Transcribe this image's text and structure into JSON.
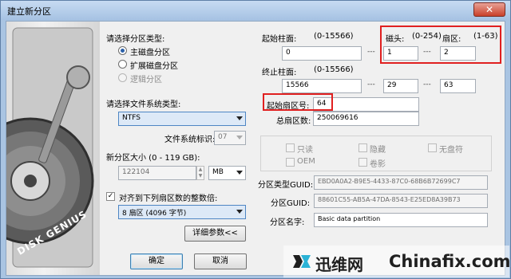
{
  "window": {
    "title": "建立新分区",
    "close_glyph": "✕"
  },
  "partition_type": {
    "label": "请选择分区类型:",
    "options": [
      {
        "label": "主磁盘分区",
        "selected": true,
        "enabled": true
      },
      {
        "label": "扩展磁盘分区",
        "selected": false,
        "enabled": true
      },
      {
        "label": "逻辑分区",
        "selected": false,
        "enabled": false
      }
    ]
  },
  "filesystem": {
    "label": "请选择文件系统类型:",
    "value": "NTFS",
    "id_label": "文件系统标识:",
    "id_value": "07"
  },
  "size": {
    "label": "新分区大小 (0 - 119 GB):",
    "value": "122104",
    "unit": "MB"
  },
  "align": {
    "checked": true,
    "label": "对齐到下列扇区数的整数倍:",
    "value": "8 扇区 (4096 字节)",
    "check_glyph": "✓"
  },
  "advanced_button": "详细参数<<",
  "start_cylinder": {
    "label": "起始柱面:",
    "range": "(0-15566)",
    "value": "0"
  },
  "start_head": {
    "label": "磁头:",
    "range": "(0-254)",
    "value": "1"
  },
  "start_sector": {
    "label": "扇区:",
    "range": "(1-63)",
    "value": "2"
  },
  "end_cylinder": {
    "label": "终止柱面:",
    "range": "(0-15566)",
    "value": "15566"
  },
  "end_head": {
    "value": "29"
  },
  "end_sector": {
    "value": "63"
  },
  "dash": "---",
  "start_lba": {
    "label": "起始扇区号:",
    "value": "64"
  },
  "total_sectors": {
    "label": "总扇区数:",
    "value": "250069616"
  },
  "flags": [
    {
      "label": "只读"
    },
    {
      "label": "隐藏"
    },
    {
      "label": "无盘符"
    },
    {
      "label": "OEM"
    },
    {
      "label": "卷影"
    }
  ],
  "type_guid": {
    "label": "分区类型GUID:",
    "value": "EBD0A0A2-B9E5-4433-87C0-68B6B72699C7"
  },
  "part_guid": {
    "label": "分区GUID:",
    "value": "88601C55-AB5A-47DA-8543-E25ED8A39B73"
  },
  "part_name": {
    "label": "分区名字:",
    "value": "Basic data partition"
  },
  "buttons": {
    "ok": "确定",
    "cancel": "取消"
  },
  "disk_brand": "DISK GENIUS",
  "watermark": {
    "cn": "迅维网",
    "en": "Chinafix.com"
  },
  "colors": {
    "highlight": "#e02020",
    "accent": "#2a5fa8",
    "titlebar": "#a9c4e2"
  }
}
